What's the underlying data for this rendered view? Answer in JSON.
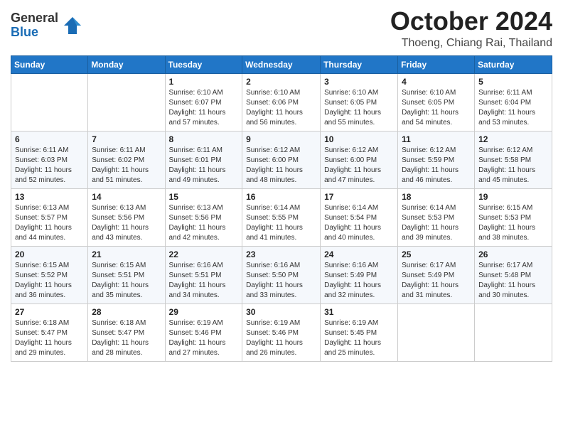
{
  "logo": {
    "general": "General",
    "blue": "Blue"
  },
  "title": "October 2024",
  "subtitle": "Thoeng, Chiang Rai, Thailand",
  "days_of_week": [
    "Sunday",
    "Monday",
    "Tuesday",
    "Wednesday",
    "Thursday",
    "Friday",
    "Saturday"
  ],
  "weeks": [
    [
      {
        "day": "",
        "info": ""
      },
      {
        "day": "",
        "info": ""
      },
      {
        "day": "1",
        "info": "Sunrise: 6:10 AM\nSunset: 6:07 PM\nDaylight: 11 hours and 57 minutes."
      },
      {
        "day": "2",
        "info": "Sunrise: 6:10 AM\nSunset: 6:06 PM\nDaylight: 11 hours and 56 minutes."
      },
      {
        "day": "3",
        "info": "Sunrise: 6:10 AM\nSunset: 6:05 PM\nDaylight: 11 hours and 55 minutes."
      },
      {
        "day": "4",
        "info": "Sunrise: 6:10 AM\nSunset: 6:05 PM\nDaylight: 11 hours and 54 minutes."
      },
      {
        "day": "5",
        "info": "Sunrise: 6:11 AM\nSunset: 6:04 PM\nDaylight: 11 hours and 53 minutes."
      }
    ],
    [
      {
        "day": "6",
        "info": "Sunrise: 6:11 AM\nSunset: 6:03 PM\nDaylight: 11 hours and 52 minutes."
      },
      {
        "day": "7",
        "info": "Sunrise: 6:11 AM\nSunset: 6:02 PM\nDaylight: 11 hours and 51 minutes."
      },
      {
        "day": "8",
        "info": "Sunrise: 6:11 AM\nSunset: 6:01 PM\nDaylight: 11 hours and 49 minutes."
      },
      {
        "day": "9",
        "info": "Sunrise: 6:12 AM\nSunset: 6:00 PM\nDaylight: 11 hours and 48 minutes."
      },
      {
        "day": "10",
        "info": "Sunrise: 6:12 AM\nSunset: 6:00 PM\nDaylight: 11 hours and 47 minutes."
      },
      {
        "day": "11",
        "info": "Sunrise: 6:12 AM\nSunset: 5:59 PM\nDaylight: 11 hours and 46 minutes."
      },
      {
        "day": "12",
        "info": "Sunrise: 6:12 AM\nSunset: 5:58 PM\nDaylight: 11 hours and 45 minutes."
      }
    ],
    [
      {
        "day": "13",
        "info": "Sunrise: 6:13 AM\nSunset: 5:57 PM\nDaylight: 11 hours and 44 minutes."
      },
      {
        "day": "14",
        "info": "Sunrise: 6:13 AM\nSunset: 5:56 PM\nDaylight: 11 hours and 43 minutes."
      },
      {
        "day": "15",
        "info": "Sunrise: 6:13 AM\nSunset: 5:56 PM\nDaylight: 11 hours and 42 minutes."
      },
      {
        "day": "16",
        "info": "Sunrise: 6:14 AM\nSunset: 5:55 PM\nDaylight: 11 hours and 41 minutes."
      },
      {
        "day": "17",
        "info": "Sunrise: 6:14 AM\nSunset: 5:54 PM\nDaylight: 11 hours and 40 minutes."
      },
      {
        "day": "18",
        "info": "Sunrise: 6:14 AM\nSunset: 5:53 PM\nDaylight: 11 hours and 39 minutes."
      },
      {
        "day": "19",
        "info": "Sunrise: 6:15 AM\nSunset: 5:53 PM\nDaylight: 11 hours and 38 minutes."
      }
    ],
    [
      {
        "day": "20",
        "info": "Sunrise: 6:15 AM\nSunset: 5:52 PM\nDaylight: 11 hours and 36 minutes."
      },
      {
        "day": "21",
        "info": "Sunrise: 6:15 AM\nSunset: 5:51 PM\nDaylight: 11 hours and 35 minutes."
      },
      {
        "day": "22",
        "info": "Sunrise: 6:16 AM\nSunset: 5:51 PM\nDaylight: 11 hours and 34 minutes."
      },
      {
        "day": "23",
        "info": "Sunrise: 6:16 AM\nSunset: 5:50 PM\nDaylight: 11 hours and 33 minutes."
      },
      {
        "day": "24",
        "info": "Sunrise: 6:16 AM\nSunset: 5:49 PM\nDaylight: 11 hours and 32 minutes."
      },
      {
        "day": "25",
        "info": "Sunrise: 6:17 AM\nSunset: 5:49 PM\nDaylight: 11 hours and 31 minutes."
      },
      {
        "day": "26",
        "info": "Sunrise: 6:17 AM\nSunset: 5:48 PM\nDaylight: 11 hours and 30 minutes."
      }
    ],
    [
      {
        "day": "27",
        "info": "Sunrise: 6:18 AM\nSunset: 5:47 PM\nDaylight: 11 hours and 29 minutes."
      },
      {
        "day": "28",
        "info": "Sunrise: 6:18 AM\nSunset: 5:47 PM\nDaylight: 11 hours and 28 minutes."
      },
      {
        "day": "29",
        "info": "Sunrise: 6:19 AM\nSunset: 5:46 PM\nDaylight: 11 hours and 27 minutes."
      },
      {
        "day": "30",
        "info": "Sunrise: 6:19 AM\nSunset: 5:46 PM\nDaylight: 11 hours and 26 minutes."
      },
      {
        "day": "31",
        "info": "Sunrise: 6:19 AM\nSunset: 5:45 PM\nDaylight: 11 hours and 25 minutes."
      },
      {
        "day": "",
        "info": ""
      },
      {
        "day": "",
        "info": ""
      }
    ]
  ]
}
